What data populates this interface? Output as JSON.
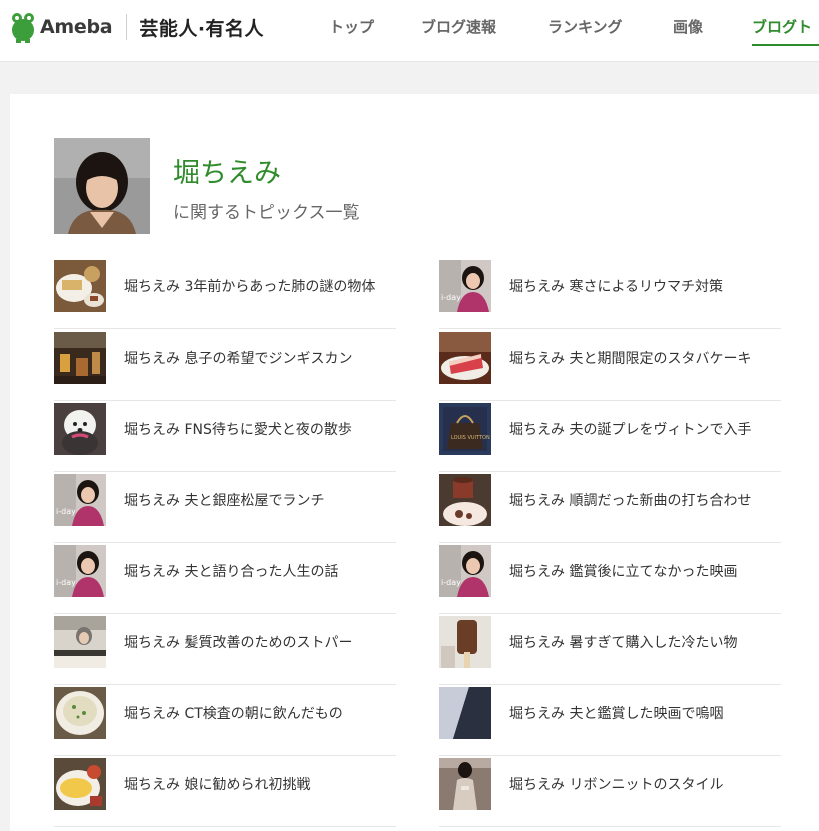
{
  "header": {
    "brand": "Ameba",
    "section": "芸能人·有名人",
    "nav": [
      "トップ",
      "ブログ速報",
      "ランキング",
      "画像",
      "ブログト"
    ],
    "active_index": 4,
    "colors": {
      "accent": "#2f8b2b",
      "logo_green": "#3c9e3a"
    }
  },
  "profile": {
    "name": "堀ちえみ",
    "subtitle": "に関するトピックス一覧",
    "icon": "profile-photo"
  },
  "topics_left": [
    {
      "title": "堀ちえみ 3年前からあった肺の謎の物体",
      "thumb": "food-plate"
    },
    {
      "title": "堀ちえみ 息子の希望でジンギスカン",
      "thumb": "restaurant"
    },
    {
      "title": "堀ちえみ FNS待ちに愛犬と夜の散歩",
      "thumb": "white-dog"
    },
    {
      "title": "堀ちえみ 夫と銀座松屋でランチ",
      "thumb": "portrait-day"
    },
    {
      "title": "堀ちえみ 夫と語り合った人生の話",
      "thumb": "portrait-day"
    },
    {
      "title": "堀ちえみ 髪質改善のためのストパー",
      "thumb": "salon"
    },
    {
      "title": "堀ちえみ CT検査の朝に飲んだもの",
      "thumb": "soup-bowl"
    },
    {
      "title": "堀ちえみ 娘に勧められ初挑戦",
      "thumb": "omelette-plate"
    }
  ],
  "topics_right": [
    {
      "title": "堀ちえみ 寒さによるリウマチ対策",
      "thumb": "portrait-day"
    },
    {
      "title": "堀ちえみ 夫と期間限定のスタバケーキ",
      "thumb": "cake"
    },
    {
      "title": "堀ちえみ 夫の誕プレをヴィトンで入手",
      "thumb": "bag"
    },
    {
      "title": "堀ちえみ 順調だった新曲の打ち合わせ",
      "thumb": "coffee-cup"
    },
    {
      "title": "堀ちえみ 鑑賞後に立てなかった映画",
      "thumb": "portrait-day"
    },
    {
      "title": "堀ちえみ 暑すぎて購入した冷たい物",
      "thumb": "ice-bar"
    },
    {
      "title": "堀ちえみ 夫と鑑賞した映画で嗚咽",
      "thumb": "cinema"
    },
    {
      "title": "堀ちえみ リボンニットのスタイル",
      "thumb": "outfit"
    }
  ]
}
